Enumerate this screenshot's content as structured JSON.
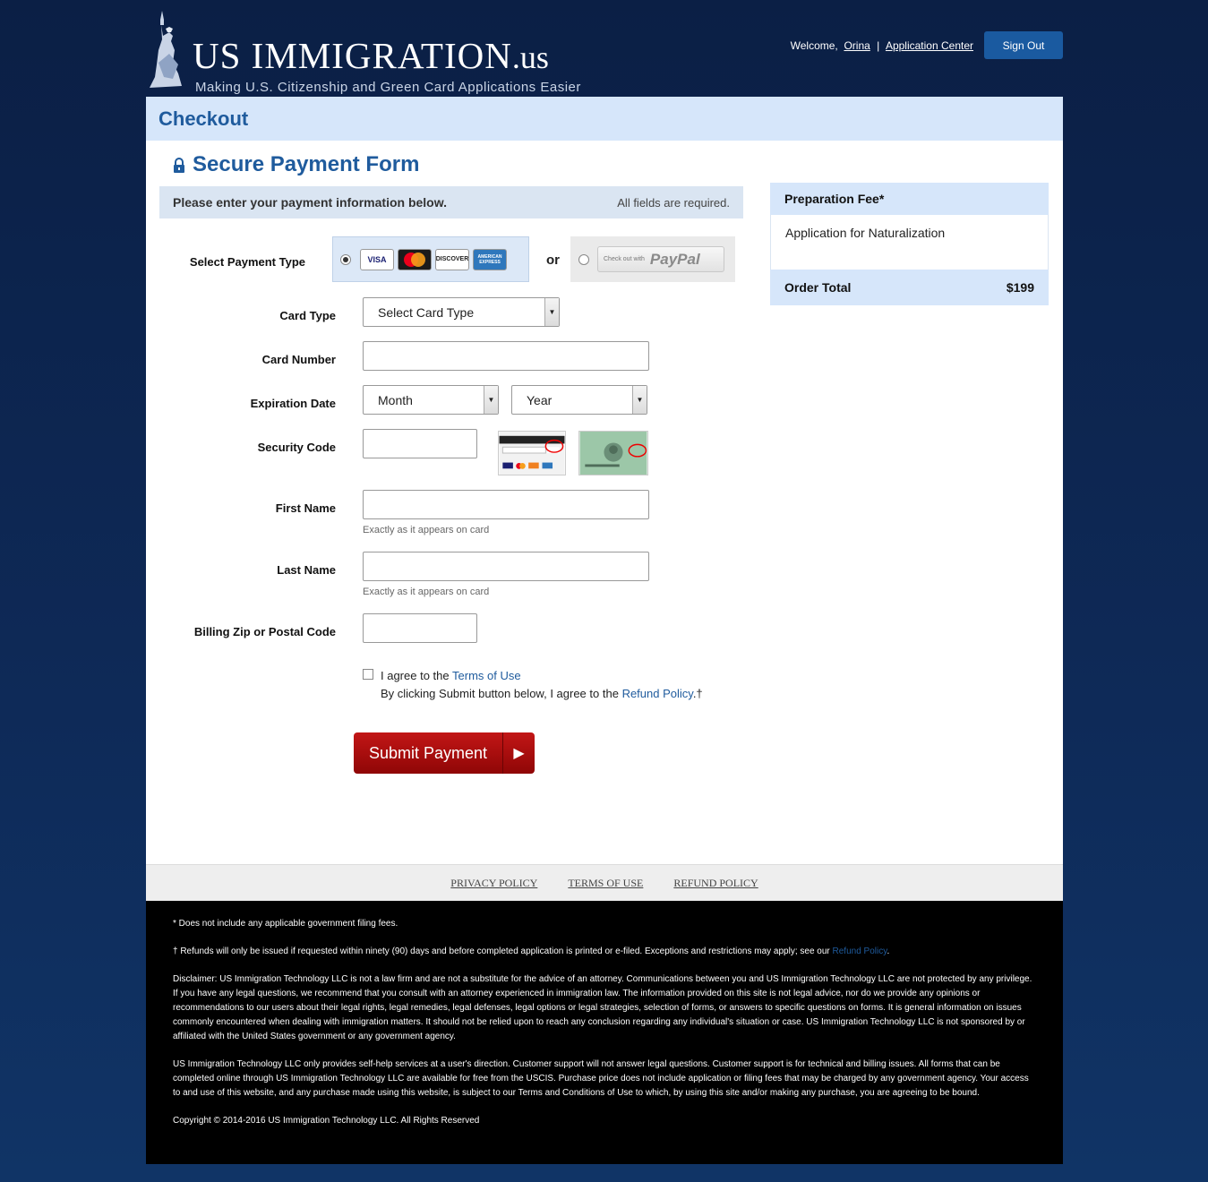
{
  "header": {
    "logo_title": "US IMMIGRATION",
    "logo_tld": ".us",
    "logo_tagline": "Making U.S. Citizenship and Green Card Applications Easier",
    "welcome": "Welcome,",
    "user_name": "Orina",
    "separator": "|",
    "application_center": "Application Center",
    "sign_out": "Sign Out"
  },
  "checkout": {
    "title": "Checkout",
    "form_title": "Secure Payment Form",
    "info_lead": "Please enter your payment information below.",
    "info_required": "All fields are required."
  },
  "form": {
    "payment_type_label": "Select Payment Type",
    "card_logos": [
      "VISA",
      "MasterCard",
      "DISCOVER",
      "AMERICAN EXPRESS"
    ],
    "or": "or",
    "paypal_small": "Check out with",
    "paypal_brand": "PayPal",
    "card_type_label": "Card Type",
    "card_type_value": "Select Card Type",
    "card_number_label": "Card Number",
    "expiration_label": "Expiration Date",
    "month_value": "Month",
    "year_value": "Year",
    "security_label": "Security Code",
    "first_name_label": "First Name",
    "last_name_label": "Last Name",
    "name_hint": "Exactly as it appears on card",
    "zip_label": "Billing Zip or Postal Code",
    "agree_prefix": "I agree to the",
    "agree_link": "Terms of Use",
    "submit_note_prefix": "By clicking Submit button below, I agree to the",
    "submit_note_link": "Refund Policy",
    "submit_note_suffix": ".†",
    "submit_label": "Submit Payment"
  },
  "sidebar": {
    "head": "Preparation Fee*",
    "item": "Application for Naturalization",
    "total_label": "Order Total",
    "total_value": "$199"
  },
  "footer_links": [
    "PRIVACY POLICY",
    "TERMS OF USE",
    "REFUND POLICY"
  ],
  "footer": {
    "note1": "* Does not include any applicable government filing fees.",
    "note2_prefix": "† Refunds will only be issued if requested within ninety (90) days and before completed application is printed or e-filed. Exceptions and restrictions may apply; see our",
    "note2_link": "Refund Policy",
    "note2_suffix": ".",
    "disclaimer": "Disclaimer: US Immigration Technology LLC is not a law firm and are not a substitute for the advice of an attorney. Communications between you and US Immigration Technology LLC are not protected by any privilege. If you have any legal questions, we recommend that you consult with an attorney experienced in immigration law. The information provided on this site is not legal advice, nor do we provide any opinions or recommendations to our users about their legal rights, legal remedies, legal defenses, legal options or legal strategies, selection of forms, or answers to specific questions on forms. It is general information on issues commonly encountered when dealing with immigration matters. It should not be relied upon to reach any conclusion regarding any individual's situation or case. US Immigration Technology LLC is not sponsored by or affiliated with the United States government or any government agency.",
    "services": "US Immigration Technology LLC only provides self-help services at a user's direction. Customer support will not answer legal questions. Customer support is for technical and billing issues. All forms that can be completed online through US Immigration Technology LLC are available for free from the USCIS. Purchase price does not include application or filing fees that may be charged by any government agency. Your access to and use of this website, and any purchase made using this website, is subject to our Terms and Conditions of Use to which, by using this site and/or making any purchase, you are agreeing to be bound.",
    "copyright": "Copyright © 2014-2016 US Immigration Technology LLC. All Rights Reserved"
  },
  "colors": {
    "brand_blue": "#1f5b9d",
    "light_blue": "#d6e6fa",
    "submit_red": "#b11010",
    "background_navy": "#0b1f45"
  },
  "icons": [
    "statue-of-liberty-icon",
    "lock-icon",
    "caret-down-icon",
    "play-arrow-icon"
  ]
}
